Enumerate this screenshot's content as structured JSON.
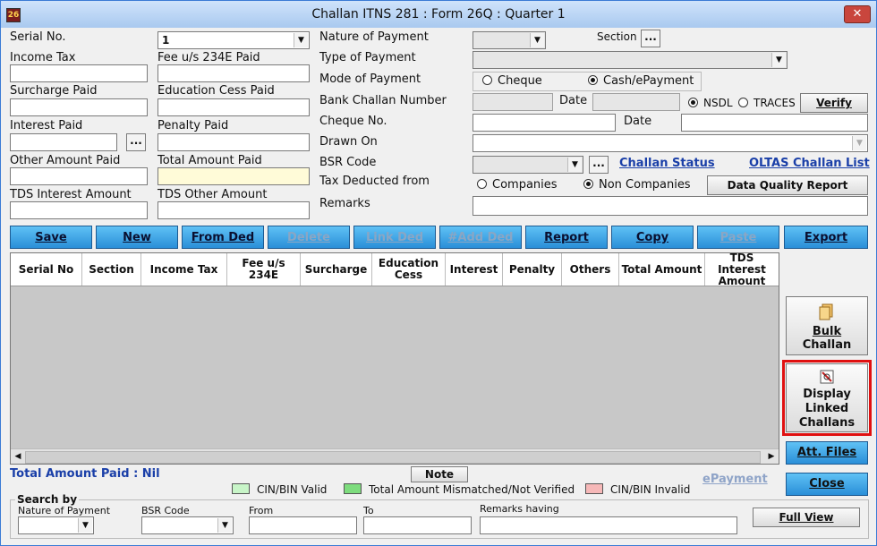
{
  "window": {
    "title": "Challan ITNS 281 : Form 26Q : Quarter 1",
    "icon_text": "26",
    "close_glyph": "✕"
  },
  "left": {
    "serial_no_label": "Serial No.",
    "serial_no_value": "1",
    "income_tax_label": "Income Tax",
    "fee_234e_label": "Fee u/s 234E Paid",
    "surcharge_label": "Surcharge Paid",
    "education_cess_label": "Education Cess Paid",
    "interest_label": "Interest Paid",
    "penalty_label": "Penalty Paid",
    "other_amount_label": "Other Amount Paid",
    "total_amount_label": "Total Amount Paid",
    "tds_interest_label": "TDS Interest Amount",
    "tds_other_label": "TDS Other Amount",
    "dots": "..."
  },
  "right": {
    "nature_label": "Nature of Payment",
    "section_label": "Section",
    "type_label": "Type of Payment",
    "mode_label": "Mode of Payment",
    "mode_cheque": "Cheque",
    "mode_cash": "Cash/ePayment",
    "bank_challan_label": "Bank Challan Number",
    "date_label": "Date",
    "nsdl_label": "NSDL",
    "traces_label": "TRACES",
    "verify_label": "Verify",
    "cheque_no_label": "Cheque No.",
    "cheque_date_label": "Date",
    "drawn_on_label": "Drawn On",
    "bsr_label": "BSR Code",
    "challan_status": "Challan Status",
    "oltas": "OLTAS Challan List",
    "tax_deducted_label": "Tax Deducted from",
    "companies": "Companies",
    "non_companies": "Non Companies",
    "data_quality": "Data Quality Report",
    "remarks_label": "Remarks"
  },
  "toolbar": [
    "Save",
    "New",
    "From Ded",
    "Delete",
    "Link Ded",
    "#Add Ded",
    "Report",
    "Copy",
    "Paste",
    "Export"
  ],
  "grid": {
    "columns": [
      "Serial No",
      "Section",
      "Income Tax",
      "Fee u/s 234E",
      "Surcharge",
      "Education Cess",
      "Interest",
      "Penalty",
      "Others",
      "Total Amount",
      "TDS Interest Amount"
    ]
  },
  "side": {
    "bulk_line1": "Bulk",
    "bulk_line2": "Challan",
    "display_line1": "Display",
    "display_line2": "Linked",
    "display_line3": "Challans",
    "att_files": "Att. Files",
    "close": "Close"
  },
  "footer": {
    "total_paid": "Total Amount Paid : Nil",
    "note": "Note",
    "epayment": "ePayment",
    "legend": [
      {
        "label": "CIN/BIN Valid",
        "color": "#c8f5c8"
      },
      {
        "label": "Total Amount Mismatched/Not Verified",
        "color": "#7ddc7d"
      },
      {
        "label": "CIN/BIN Invalid",
        "color": "#f6b8b8"
      }
    ]
  },
  "search": {
    "title": "Search by",
    "nature_label": "Nature of Payment",
    "bsr_label": "BSR Code",
    "from_label": "From",
    "to_label": "To",
    "remarks_label": "Remarks having",
    "full_view": "Full View"
  }
}
